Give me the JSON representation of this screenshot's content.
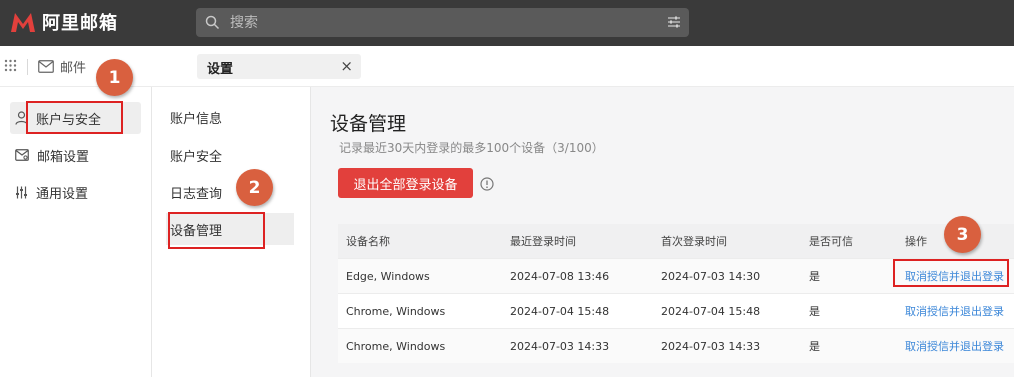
{
  "app": {
    "logo_text": "阿里邮箱",
    "brand_color": "#e2403c"
  },
  "search": {
    "placeholder": "搜索"
  },
  "nav": {
    "mail_label": "邮件",
    "open_tab_label": "设置"
  },
  "sidebar": {
    "items": [
      {
        "label": "账户与安全",
        "icon": "user-icon"
      },
      {
        "label": "邮箱设置",
        "icon": "mailbox-icon"
      },
      {
        "label": "通用设置",
        "icon": "sliders-icon"
      }
    ]
  },
  "subnav": {
    "items": [
      {
        "label": "账户信息"
      },
      {
        "label": "账户安全"
      },
      {
        "label": "日志查询"
      },
      {
        "label": "设备管理"
      }
    ]
  },
  "main": {
    "title": "设备管理",
    "subtitle": "记录最近30天内登录的最多100个设备（3/100）",
    "logout_all_label": "退出全部登录设备",
    "columns": [
      "设备名称",
      "最近登录时间",
      "首次登录时间",
      "是否可信",
      "操作"
    ],
    "rows": [
      {
        "device": "Edge, Windows",
        "last_login": "2024-07-08 13:46",
        "first_login": "2024-07-03 14:30",
        "trusted": "是",
        "action": "取消授信并退出登录"
      },
      {
        "device": "Chrome, Windows",
        "last_login": "2024-07-04 15:48",
        "first_login": "2024-07-04 15:48",
        "trusted": "是",
        "action": "取消授信并退出登录"
      },
      {
        "device": "Chrome, Windows",
        "last_login": "2024-07-03 14:33",
        "first_login": "2024-07-03 14:33",
        "trusted": "是",
        "action": "取消授信并退出登录"
      }
    ]
  },
  "annotations": {
    "step1": "1",
    "step2": "2",
    "step3": "3",
    "callout_color": "#d9603f",
    "box_color": "#dd2222"
  }
}
